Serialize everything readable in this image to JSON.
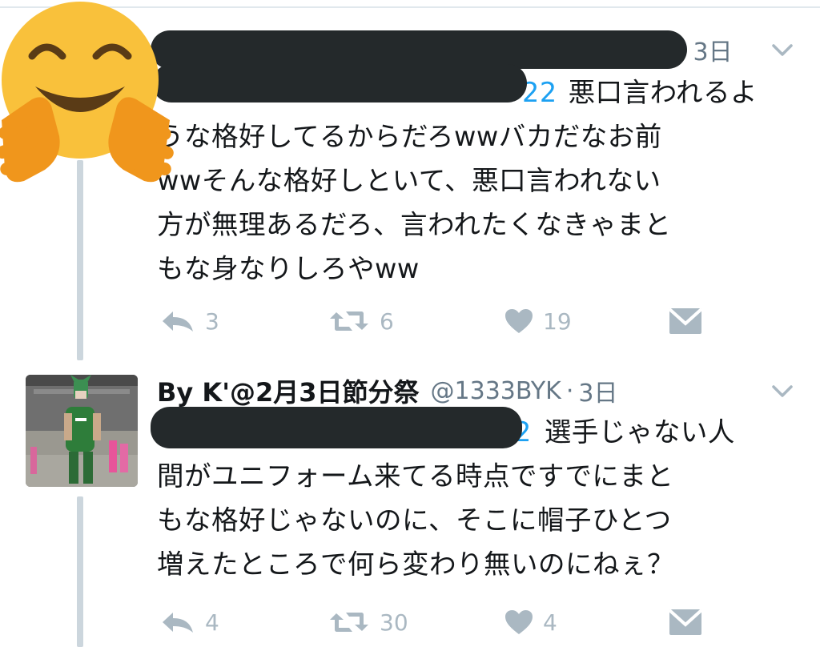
{
  "tweets": [
    {
      "display_name": "",
      "handle": "",
      "dot": "·",
      "time": "3日",
      "mention_fragment": "22",
      "lines": [
        "悪口言われるよ",
        "うな格好してるからだろwwバカだなお前",
        "wwそんな格好しといて、悪口言われない",
        "方が無理あるだろ、言われたくなきゃまと",
        "もな身なりしろやww"
      ],
      "reply_count": "3",
      "retweet_count": "6",
      "like_count": "19"
    },
    {
      "display_name": "By K'@2月3日節分祭",
      "handle": "@1333BYK",
      "dot": "·",
      "time": "3日",
      "mention_fragment": "2",
      "lines": [
        "選手じゃない人",
        "間がユニフォーム来てる時点ですでにまと",
        "もな格好じゃないのに、そこに帽子ひとつ",
        "増えたところで何ら変わり無いのにねぇ？"
      ],
      "reply_count": "4",
      "retweet_count": "30",
      "like_count": "4"
    }
  ],
  "icons": {
    "reply": "reply-icon",
    "retweet": "retweet-icon",
    "like": "heart-icon",
    "dm": "direct-message-icon",
    "caret": "chevron-down-icon",
    "sticker": "hugging-face-emoji"
  },
  "colors": {
    "link": "#1da1f2",
    "muted": "#657786",
    "action": "#aab8c2",
    "redaction": "#24292b",
    "thread_line": "#ccd6dd"
  }
}
